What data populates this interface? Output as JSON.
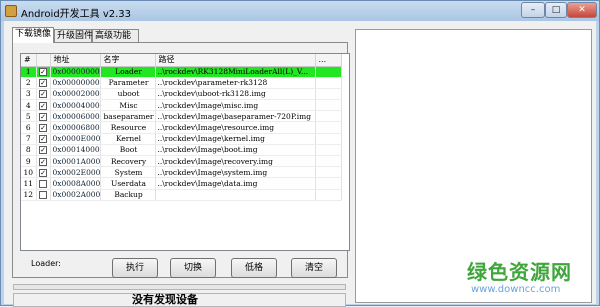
{
  "window": {
    "title": "Android开发工具 v2.33",
    "minimize": "–",
    "maximize": "□",
    "close": "✕"
  },
  "tabs": [
    {
      "label": "下载镜像"
    },
    {
      "label": "升级固件"
    },
    {
      "label": "高级功能"
    }
  ],
  "table": {
    "headers": [
      "#",
      "",
      "地址",
      "名字",
      "路径",
      "..."
    ],
    "rows": [
      {
        "num": "1",
        "checked": true,
        "addr": "0x00000000",
        "name": "Loader",
        "path": "..\\rockdev\\RK3128MiniLoaderAll(L)_V...",
        "selected": true
      },
      {
        "num": "2",
        "checked": true,
        "addr": "0x00000000",
        "name": "Parameter",
        "path": "..\\rockdev\\parameter-rk3128"
      },
      {
        "num": "3",
        "checked": true,
        "addr": "0x00002000",
        "name": "uboot",
        "path": "..\\rockdev\\uboot-rk3128.img"
      },
      {
        "num": "4",
        "checked": true,
        "addr": "0x00004000",
        "name": "Misc",
        "path": "..\\rockdev\\Image\\misc.img"
      },
      {
        "num": "5",
        "checked": true,
        "addr": "0x00006000",
        "name": "baseparamer",
        "path": "..\\rockdev\\Image\\baseparamer-720P.img"
      },
      {
        "num": "6",
        "checked": true,
        "addr": "0x00006800",
        "name": "Resource",
        "path": "..\\rockdev\\Image\\resource.img"
      },
      {
        "num": "7",
        "checked": true,
        "addr": "0x0000E000",
        "name": "Kernel",
        "path": "..\\rockdev\\Image\\kernel.img"
      },
      {
        "num": "8",
        "checked": true,
        "addr": "0x00014000",
        "name": "Boot",
        "path": "..\\rockdev\\Image\\boot.img"
      },
      {
        "num": "9",
        "checked": true,
        "addr": "0x0001A000",
        "name": "Recovery",
        "path": "..\\rockdev\\Image\\recovery.img"
      },
      {
        "num": "10",
        "checked": true,
        "addr": "0x0002E000",
        "name": "System",
        "path": "..\\rockdev\\Image\\system.img"
      },
      {
        "num": "11",
        "checked": false,
        "addr": "0x0008A000",
        "name": "Userdata",
        "path": "..\\rockdev\\Image\\data.img"
      },
      {
        "num": "12",
        "checked": false,
        "addr": "0x0002A000",
        "name": "Backup",
        "path": ""
      }
    ]
  },
  "loader_label": "Loader:",
  "buttons": [
    {
      "label": "执行"
    },
    {
      "label": "切换"
    },
    {
      "label": "低格"
    },
    {
      "label": "清空"
    }
  ],
  "status": {
    "text": "没有发现设备"
  },
  "watermark": {
    "main": "绿色资源网",
    "sub": "www.downcc.com"
  },
  "colors": {
    "selected_row": "#22e622",
    "title_bar": "#bcd3ea",
    "watermark_green": "#3fa63b"
  }
}
